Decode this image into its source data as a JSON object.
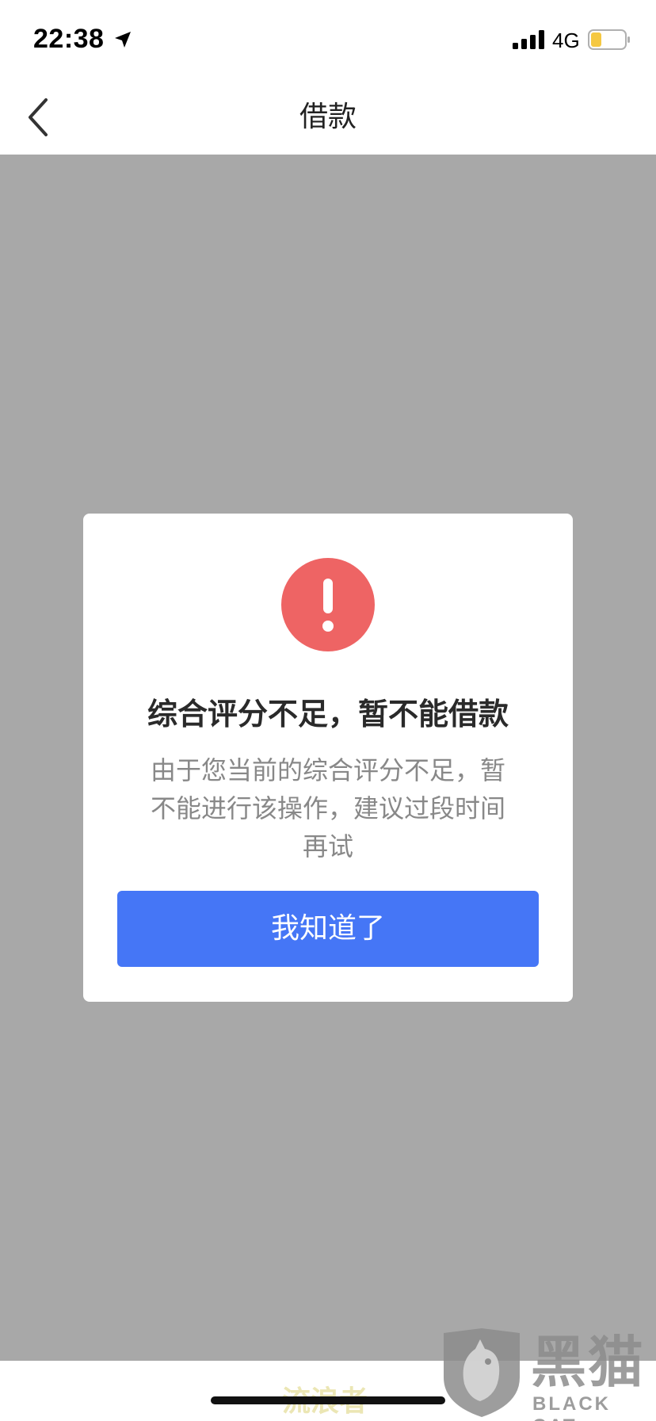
{
  "status_bar": {
    "time": "22:38",
    "network": "4G",
    "icons": [
      "location-arrow-icon",
      "signal-icon",
      "battery-icon"
    ],
    "battery_color": "#f5c842"
  },
  "nav": {
    "title": "借款",
    "back_icon": "chevron-left-icon"
  },
  "dialog": {
    "icon": "exclamation-circle-icon",
    "icon_color": "#ee6464",
    "title": "综合评分不足，暂不能借款",
    "message_line1": "由于您当前的综合评分不足，暂",
    "message_line2": "不能进行该操作，建议过段时间",
    "message_line3": "再试",
    "confirm_label": "我知道了",
    "confirm_color": "#4576f6"
  },
  "overlay_color": "#a8a8a8",
  "watermark": {
    "text": "流浪者",
    "brand_cn": "黑猫",
    "brand_en": "BLACK CAT"
  }
}
